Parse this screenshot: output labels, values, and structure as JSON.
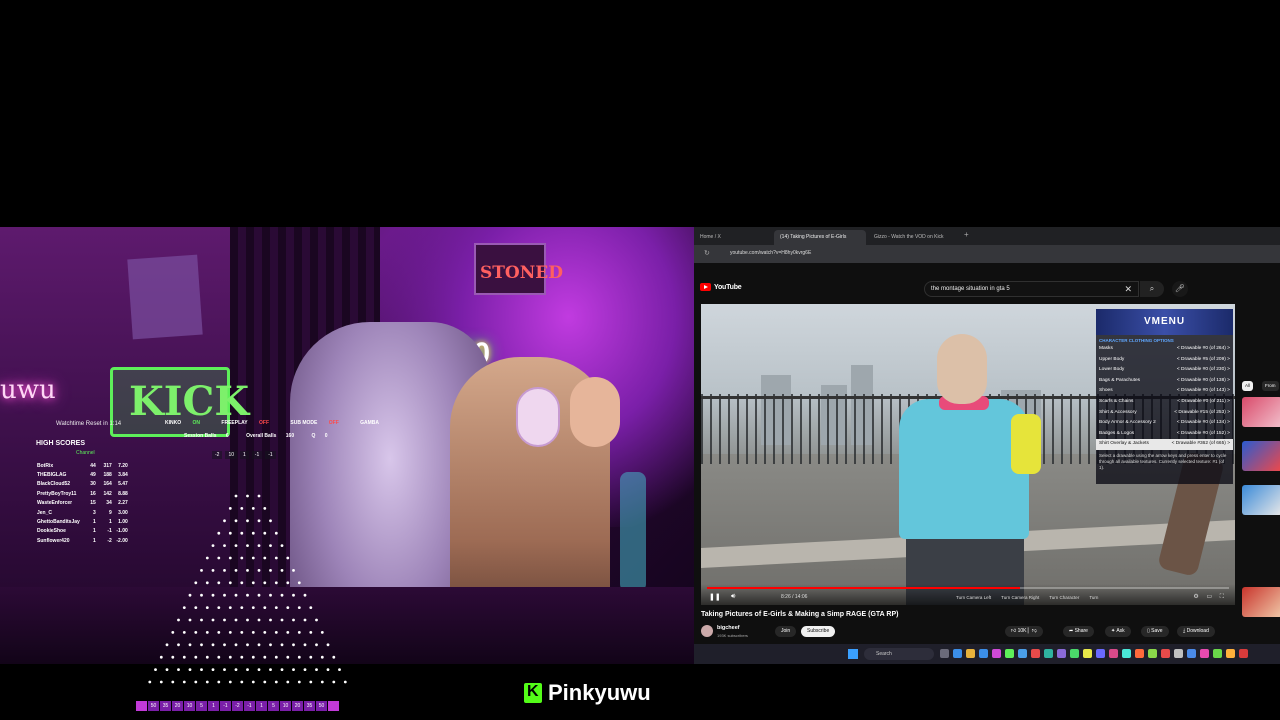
{
  "overlay": {
    "watchtime": "Watchtime Reset in 1:14",
    "high_scores_title": "HIGH SCORES",
    "high_scores_sub": "Channel",
    "scores": [
      {
        "name": "BotRix",
        "a": "44",
        "b": "317",
        "c": "7.20"
      },
      {
        "name": "THEBIGLAG",
        "a": "49",
        "b": "188",
        "c": "3.84"
      },
      {
        "name": "BlackCloud52",
        "a": "30",
        "b": "164",
        "c": "5.47"
      },
      {
        "name": "PrettyBoyTroy11",
        "a": "16",
        "b": "142",
        "b2": "",
        "c": "8.88"
      },
      {
        "name": "WasteEnforcer",
        "a": "15",
        "b": "34",
        "c": "2.27"
      },
      {
        "name": "Jen_C",
        "a": "3",
        "b": "9",
        "c": "3.00"
      },
      {
        "name": "GhettoBanditsJay",
        "a": "1",
        "b": "1",
        "c": "1.00"
      },
      {
        "name": "DookieShoe",
        "a": "1",
        "b": "-1",
        "c": "-1.00"
      },
      {
        "name": "Sunflower420",
        "a": "1",
        "b": "-2",
        "c": "-2.00"
      }
    ],
    "modes": {
      "kinko": "KINKO",
      "kinko_state": "ON",
      "freeplay": "FREEPLAY",
      "freeplay_state": "OFF",
      "submode": "SUB MODE",
      "submode_state": "OFF",
      "gamba": "GAMBA"
    },
    "session_label": "Session Balls",
    "session_value": "6",
    "overall_label": "Overall Balls",
    "overall_value": "160",
    "q_label": "Q",
    "q_value": "0",
    "mini_ticks": [
      "-2",
      "10",
      "1",
      "-1",
      "-1"
    ],
    "pegs": [
      "",
      "50",
      "35",
      "20",
      "10",
      "5",
      "1",
      "-1",
      "-2",
      "-1",
      "1",
      "5",
      "10",
      "20",
      "35",
      "50",
      ""
    ]
  },
  "brand": {
    "name": "Pinkyuwu"
  },
  "browser": {
    "tabs": [
      {
        "label": "Home / X"
      },
      {
        "label": "(14) Taking Pictures of E-Girls"
      },
      {
        "label": "Gizzo - Watch the VOD on Kick"
      }
    ],
    "url": "youtube.com/watch?v=H8hy0kvrg6E",
    "yt_logo": "YouTube",
    "search_query": "the montage situation in gta 5",
    "video": {
      "title": "Taking Pictures of E-Girls & Making a Simp RAGE (GTA RP)",
      "time": "8:26 / 14:06",
      "progress": 0.6,
      "channel": "bigcheef",
      "subs": "193K subscribers",
      "join": "Join",
      "subscribe": "Subscribe",
      "likes": "10K",
      "share": "Share",
      "ask": "Ask",
      "save": "Save",
      "download": "Download"
    },
    "vmenu": {
      "banner": "VMENU",
      "subtitle": "CHARACTER CLOTHING OPTIONS",
      "items": [
        {
          "label": "Masks",
          "value": "< Drawable #0 (of 264) >"
        },
        {
          "label": "Upper Body",
          "value": "< Drawable #5 (of 209) >"
        },
        {
          "label": "Lower Body",
          "value": "< Drawable #0 (of 230) >"
        },
        {
          "label": "Bags & Parachutes",
          "value": "< Drawable #0 (of 138) >"
        },
        {
          "label": "Shoes",
          "value": "< Drawable #0 (of 143) >"
        },
        {
          "label": "Scarfs & Chains",
          "value": "< Drawable #0 (of 211) >"
        },
        {
          "label": "Shirt & Accessory",
          "value": "< Drawable #15 (of 253) >"
        },
        {
          "label": "Body Armor & Accessory 2",
          "value": "< Drawable #0 (of 134) >"
        },
        {
          "label": "Badges & Logos",
          "value": "< Drawable #0 (of 152) >"
        },
        {
          "label": "Shirt Overlay & Jackets",
          "value": "< Drawable #362 (of 665) >"
        }
      ],
      "desc": "Select a drawable using the arrow keys and press enter to cycle through all available textures. Currently selected texture: #1 (of 1)."
    },
    "hints": [
      "Turn Camera Left",
      "Turn Camera Right",
      "Turn Character",
      "Turn"
    ],
    "chips": [
      "All",
      "From"
    ],
    "taskbar_search": "Search"
  }
}
